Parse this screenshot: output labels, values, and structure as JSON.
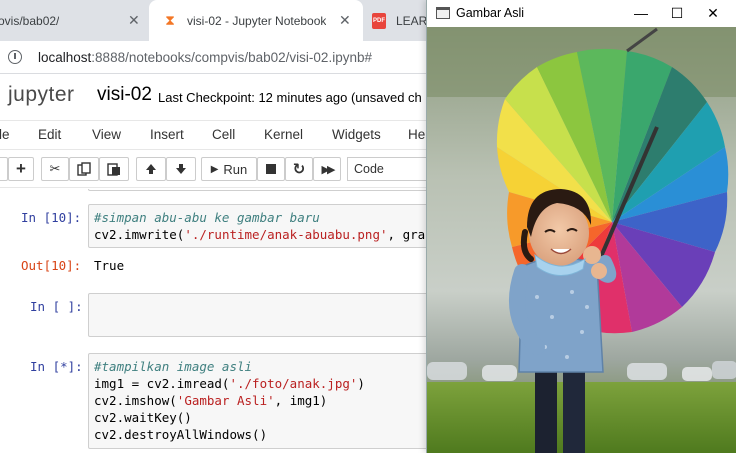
{
  "browser": {
    "tabs": [
      {
        "label": "ovis/bab02/",
        "close": "✕"
      },
      {
        "label": "visi-02 - Jupyter Notebook",
        "close": "✕"
      },
      {
        "label": "LEARN"
      }
    ],
    "url_host": "localhost",
    "url_path": ":8888/notebooks/compvis/bab02/visi-02.ipynb#"
  },
  "jupyter": {
    "logo": "jupyter",
    "title": "visi-02",
    "checkpoint": "Last Checkpoint: 12 minutes ago  (unsaved ch",
    "menu": [
      "le",
      "Edit",
      "View",
      "Insert",
      "Cell",
      "Kernel",
      "Widgets",
      "He"
    ],
    "toolbar": {
      "run_label": "Run",
      "cell_type": "Code"
    }
  },
  "cells": [
    {
      "prompt": "In [10]:",
      "lines": [
        {
          "comment": "#simpan abu-abu ke gambar baru"
        },
        {
          "pre": "cv2.imwrite(",
          "str": "'./runtime/anak-abuabu.png'",
          "post": ", gra"
        }
      ],
      "out_prompt": "Out[10]:",
      "output": "True"
    },
    {
      "prompt": "In [ ]:"
    },
    {
      "prompt": "In [*]:",
      "lines": [
        {
          "comment": "#tampilkan image asli"
        },
        {
          "pre": "img1 = cv2.imread(",
          "str": "'./foto/anak.jpg'",
          "post": ")"
        },
        {
          "pre": "cv2.imshow(",
          "str": "'Gambar Asli'",
          "post": ", img1)"
        },
        {
          "pre": "cv2.waitKey()"
        },
        {
          "pre": "cv2.destroyAllWindows()"
        }
      ]
    }
  ],
  "image_window": {
    "title": "Gambar Asli",
    "minimize": "—",
    "maximize": "☐",
    "close": "✕"
  },
  "colors": {
    "jupyter_orange": "#f37726",
    "prompt_in": "#303f9f",
    "prompt_out": "#d84315",
    "comment": "#408080",
    "string": "#ba2121"
  }
}
